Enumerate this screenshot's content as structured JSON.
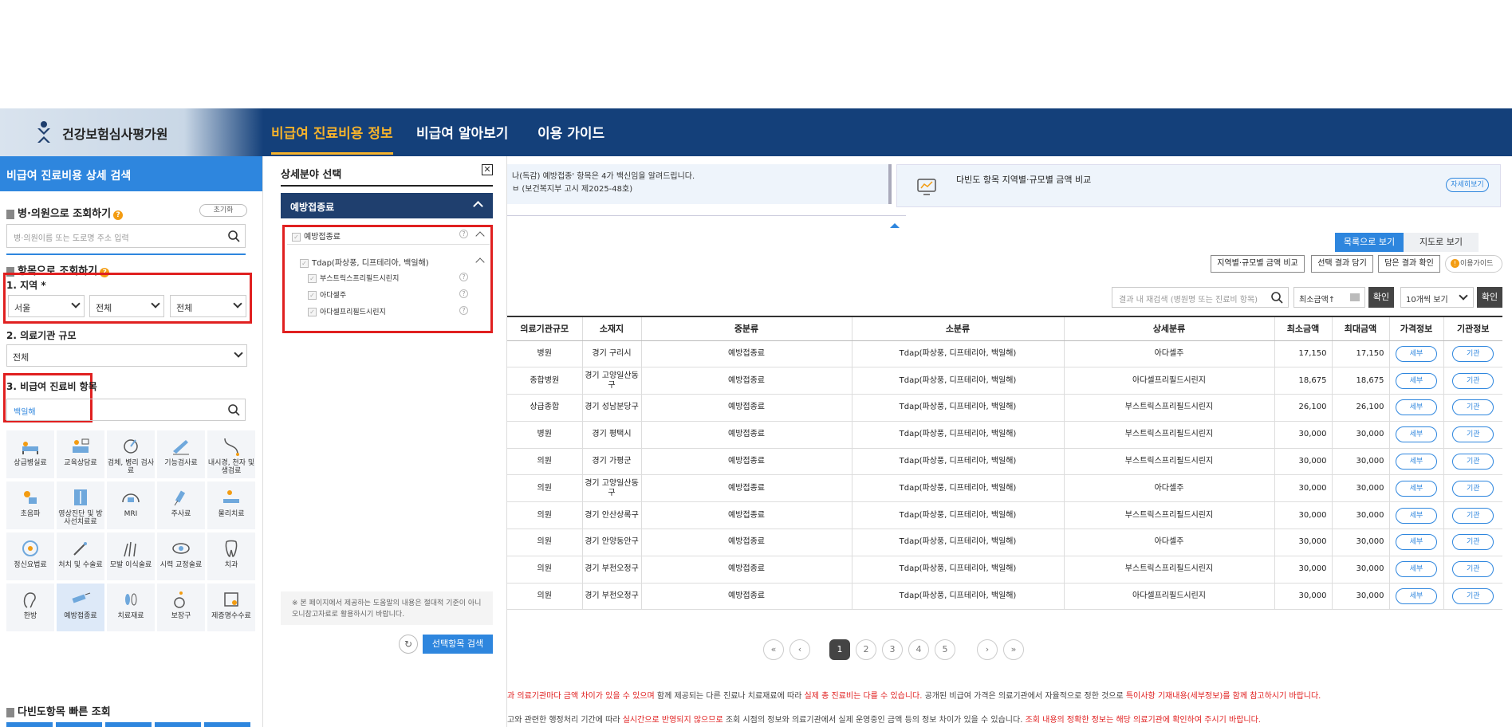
{
  "header": {
    "org_name": "건강보험심사평가원",
    "nav": [
      {
        "label": "비급여 진료비용 정보",
        "active": true
      },
      {
        "label": "비급여 알아보기",
        "active": false
      },
      {
        "label": "이용 가이드",
        "active": false
      }
    ]
  },
  "left": {
    "title": "비급여 진료비용 상세 검색",
    "hospital_search": {
      "heading": "병·의원으로 조회하기",
      "reset_label": "초기화",
      "placeholder": "병·의원이름 또는 도로명 주소 입력"
    },
    "item_search": {
      "heading": "항목으로 조회하기"
    },
    "region": {
      "label": "1. 지역 *",
      "selects": [
        "서울",
        "전체",
        "전체"
      ]
    },
    "scale": {
      "label": "2. 의료기관 규모",
      "value": "전체"
    },
    "item": {
      "label": "3. 비급여 진료비 항목",
      "value": "백일해"
    },
    "categories": [
      {
        "label": "상급병실료",
        "icon": "bed-icon",
        "selected": false
      },
      {
        "label": "교육상담료",
        "icon": "consult-icon",
        "selected": false
      },
      {
        "label": "검체, 병리 검사료",
        "icon": "microscope-icon",
        "selected": false
      },
      {
        "label": "기능검사료",
        "icon": "pen-chart-icon",
        "selected": false
      },
      {
        "label": "내시경, 천자 및 생검료",
        "icon": "endoscope-icon",
        "selected": false
      },
      {
        "label": "초음파",
        "icon": "ultrasound-icon",
        "selected": false
      },
      {
        "label": "영상진단 및 방사선치료료",
        "icon": "xray-icon",
        "selected": false
      },
      {
        "label": "MRI",
        "icon": "mri-icon",
        "selected": false
      },
      {
        "label": "주사료",
        "icon": "syringe-icon",
        "selected": false
      },
      {
        "label": "물리치료",
        "icon": "physio-icon",
        "selected": false
      },
      {
        "label": "정신요법료",
        "icon": "brain-icon",
        "selected": false
      },
      {
        "label": "처치 및 수술료",
        "icon": "surgery-icon",
        "selected": false
      },
      {
        "label": "모발 이식술료",
        "icon": "hair-icon",
        "selected": false
      },
      {
        "label": "시력 교정술료",
        "icon": "eye-icon",
        "selected": false
      },
      {
        "label": "치과",
        "icon": "tooth-icon",
        "selected": false
      },
      {
        "label": "한방",
        "icon": "ear-icon",
        "selected": false
      },
      {
        "label": "예방접종료",
        "icon": "vaccine-icon",
        "selected": true
      },
      {
        "label": "치료재료",
        "icon": "material-icon",
        "selected": false
      },
      {
        "label": "보장구",
        "icon": "wheelchair-icon",
        "selected": false
      },
      {
        "label": "제증명수수료",
        "icon": "certificate-icon",
        "selected": false
      }
    ],
    "quick": {
      "heading": "다빈도항목 빠른 조회"
    }
  },
  "middle": {
    "title": "상세분야 선택",
    "close_icon": "close-icon",
    "category": "예방접종료",
    "tree": {
      "root": "예방접종료",
      "group": "Tdap(파상풍, 디프테리아, 백일해)",
      "children": [
        "부스트릭스프리필드시린지",
        "아다셀주",
        "아다셀프리필드시린지"
      ]
    },
    "notice": "※ 본 페이지에서 제공하는 도움말의 내용은 절대적 기준이 아니오니참고자료로 활용하시기 바랍니다.",
    "search_button": "선택항목 검색"
  },
  "main": {
    "notice1_line1": "나(독감) 예방접종' 항목은 4가 백신임을 알려드립니다.",
    "notice1_line2": "ㅂ (보건복지부 고시 제2025-48호)",
    "notice2_text": "다빈도 항목 지역별·규모별 금액 비교",
    "notice2_more": "자세히보기",
    "view_list": "목록으로 보기",
    "view_map": "지도로 보기",
    "actions": [
      "지역별·규모별 금액 비교",
      "선택 결과 담기",
      "담은 결과 확인"
    ],
    "guide": "이용가이드",
    "filter_placeholder": "결과 내 재검색 (병원명 또는 진료비 항목)",
    "sort": "최소금액↑",
    "ok": "확인",
    "page_size": "10개씩 보기",
    "columns": [
      "의료기관규모",
      "소재지",
      "중분류",
      "소분류",
      "상세분류",
      "최소금액",
      "최대금액",
      "가격정보",
      "기관정보"
    ],
    "rows": [
      [
        "병원",
        "경기 구리시",
        "예방접종료",
        "Tdap(파상풍, 디프테리아, 백일해)",
        "아다셀주",
        "17,150",
        "17,150"
      ],
      [
        "종합병원",
        "경기 고양일산동구",
        "예방접종료",
        "Tdap(파상풍, 디프테리아, 백일해)",
        "아다셀프리필드시린지",
        "18,675",
        "18,675"
      ],
      [
        "상급종합",
        "경기 성남분당구",
        "예방접종료",
        "Tdap(파상풍, 디프테리아, 백일해)",
        "부스트릭스프리필드시린지",
        "26,100",
        "26,100"
      ],
      [
        "병원",
        "경기 평택시",
        "예방접종료",
        "Tdap(파상풍, 디프테리아, 백일해)",
        "부스트릭스프리필드시린지",
        "30,000",
        "30,000"
      ],
      [
        "의원",
        "경기 가평군",
        "예방접종료",
        "Tdap(파상풍, 디프테리아, 백일해)",
        "부스트릭스프리필드시린지",
        "30,000",
        "30,000"
      ],
      [
        "의원",
        "경기 고양일산동구",
        "예방접종료",
        "Tdap(파상풍, 디프테리아, 백일해)",
        "아다셀주",
        "30,000",
        "30,000"
      ],
      [
        "의원",
        "경기 안산상록구",
        "예방접종료",
        "Tdap(파상풍, 디프테리아, 백일해)",
        "부스트릭스프리필드시린지",
        "30,000",
        "30,000"
      ],
      [
        "의원",
        "경기 안양동안구",
        "예방접종료",
        "Tdap(파상풍, 디프테리아, 백일해)",
        "아다셀주",
        "30,000",
        "30,000"
      ],
      [
        "의원",
        "경기 부천오정구",
        "예방접종료",
        "Tdap(파상풍, 디프테리아, 백일해)",
        "부스트릭스프리필드시린지",
        "30,000",
        "30,000"
      ],
      [
        "의원",
        "경기 부천오정구",
        "예방접종료",
        "Tdap(파상풍, 디프테리아, 백일해)",
        "아다셀프리필드시린지",
        "30,000",
        "30,000"
      ]
    ],
    "row_btn_price": "세부",
    "row_btn_inst": "기관",
    "pages": [
      "1",
      "2",
      "3",
      "4",
      "5"
    ],
    "current_page": "1",
    "footer1": {
      "a": "과 의료기관마다 금액 차이가 있을 수 있으며",
      "b": " 함께 제공되는 다른 진료나 치료재료에 따라 ",
      "c": "실제 총 진료비는 다를 수 있습니다.",
      "d": " 공개된 비급여 가격은 의료기관에서 자율적으로 정한 것으로 ",
      "e": "특이사항 기재내용(세부정보)를 함께 참고하시기 바랍니다."
    },
    "footer2": {
      "a": "고와 관련한 행정처리 기간에 따라 ",
      "b": "실시간으로 반영되지 않으므로",
      "c": " 조회 시점의 정보와 의료기관에서 실제 운영중인 금액 등의 정보 차이가 있을 수 있습니다. ",
      "d": "조회 내용의 정확한 정보는 해당 의료기관에 확인하여 주시기 바랍니다."
    }
  },
  "colors": {
    "header_bg": "#14407a",
    "accent": "#2e86de",
    "active_nav": "#f7b32b",
    "highlight_box": "#e02020"
  }
}
